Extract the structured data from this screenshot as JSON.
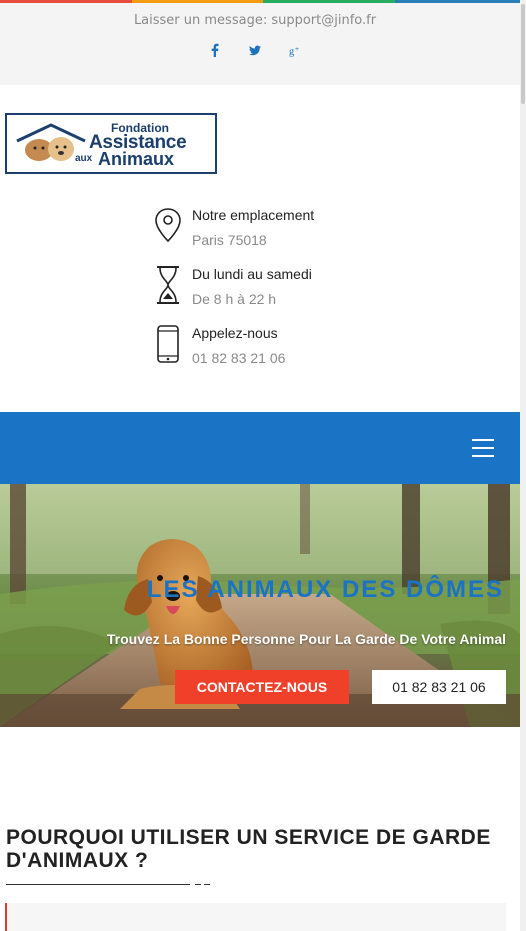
{
  "topbar": {
    "message": "Laisser un message: support@jinfo.fr",
    "social": [
      {
        "icon": "facebook-icon",
        "glyph": "f"
      },
      {
        "icon": "twitter-icon",
        "glyph": "t"
      },
      {
        "icon": "google-plus-icon",
        "glyph": "g+"
      }
    ],
    "strip_colors": [
      "#e74c3c",
      "#f39c12",
      "#27ae60",
      "#2980b9"
    ]
  },
  "logo": {
    "line1": "Fondation",
    "line2": "Assistance",
    "line3": "aux",
    "line4": "Animaux"
  },
  "info": {
    "location": {
      "title": "Notre emplacement",
      "value": "Paris 75018",
      "icon": "location-pin-icon"
    },
    "hours": {
      "title": "Du lundi au samedi",
      "value": "De 8 h à 22 h",
      "icon": "hourglass-icon"
    },
    "phone": {
      "title": "Appelez-nous",
      "value": "01 82 83 21 06",
      "icon": "mobile-phone-icon"
    }
  },
  "nav": {
    "menu_icon": "hamburger-menu-icon",
    "color": "#1a73c4"
  },
  "hero": {
    "title": "LES ANIMAUX DES DÔMES",
    "subtitle": "Trouvez La Bonne Personne Pour La Garde De Votre Animal",
    "contact_button": "CONTACTEZ-NOUS",
    "phone_button": "01 82 83 21 06",
    "accent": "#f0402a"
  },
  "section": {
    "title": "POURQUOI UTILISER UN SERVICE DE GARDE D'ANIMAUX ?"
  }
}
